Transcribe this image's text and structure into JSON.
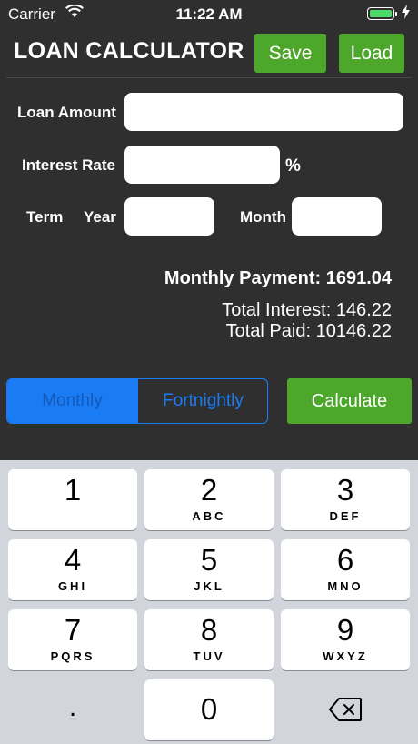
{
  "status": {
    "carrier": "Carrier",
    "time": "11:22 AM"
  },
  "header": {
    "title": "LOAN CALCULATOR",
    "save_label": "Save",
    "load_label": "Load"
  },
  "form": {
    "loan_amount_label": "Loan Amount",
    "loan_amount_value": "",
    "interest_rate_label": "Interest Rate",
    "interest_rate_value": "",
    "percent_symbol": "%",
    "term_label": "Term",
    "year_label": "Year",
    "year_value": "",
    "month_label": "Month",
    "month_value": ""
  },
  "results": {
    "monthly_payment": "Monthly Payment: 1691.04",
    "total_interest": "Total Interest: 146.22",
    "total_paid": "Total Paid: 10146.22"
  },
  "frequency": {
    "options": [
      "Monthly",
      "Fortnightly"
    ],
    "selected": "Monthly"
  },
  "calculate_label": "Calculate",
  "keypad": {
    "keys": [
      {
        "digit": "1",
        "letters": ""
      },
      {
        "digit": "2",
        "letters": "ABC"
      },
      {
        "digit": "3",
        "letters": "DEF"
      },
      {
        "digit": "4",
        "letters": "GHI"
      },
      {
        "digit": "5",
        "letters": "JKL"
      },
      {
        "digit": "6",
        "letters": "MNO"
      },
      {
        "digit": "7",
        "letters": "PQRS"
      },
      {
        "digit": "8",
        "letters": "TUV"
      },
      {
        "digit": "9",
        "letters": "WXYZ"
      }
    ],
    "decimal": ".",
    "zero": "0"
  },
  "colors": {
    "accent_green": "#4ca72a",
    "segment_blue": "#1a7cf5",
    "background": "#2f2f2f",
    "keypad_bg": "#d2d5db"
  },
  "icons": {
    "wifi": "wifi-icon",
    "battery": "battery-icon",
    "charging": "charging-bolt-icon",
    "backspace": "backspace-icon"
  }
}
